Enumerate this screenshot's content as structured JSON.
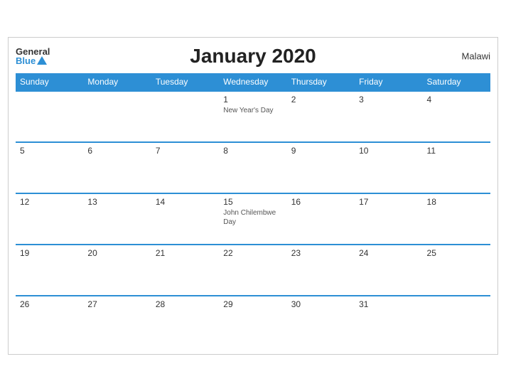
{
  "header": {
    "title": "January 2020",
    "country": "Malawi",
    "logo_general": "General",
    "logo_blue": "Blue"
  },
  "days_of_week": [
    "Sunday",
    "Monday",
    "Tuesday",
    "Wednesday",
    "Thursday",
    "Friday",
    "Saturday"
  ],
  "weeks": [
    [
      {
        "day": "",
        "empty": true
      },
      {
        "day": "",
        "empty": true
      },
      {
        "day": "",
        "empty": true
      },
      {
        "day": "1",
        "holiday": "New Year's Day"
      },
      {
        "day": "2"
      },
      {
        "day": "3"
      },
      {
        "day": "4"
      }
    ],
    [
      {
        "day": "5"
      },
      {
        "day": "6"
      },
      {
        "day": "7"
      },
      {
        "day": "8"
      },
      {
        "day": "9"
      },
      {
        "day": "10"
      },
      {
        "day": "11"
      }
    ],
    [
      {
        "day": "12"
      },
      {
        "day": "13"
      },
      {
        "day": "14"
      },
      {
        "day": "15",
        "holiday": "John Chilembwe Day"
      },
      {
        "day": "16"
      },
      {
        "day": "17"
      },
      {
        "day": "18"
      }
    ],
    [
      {
        "day": "19"
      },
      {
        "day": "20"
      },
      {
        "day": "21"
      },
      {
        "day": "22"
      },
      {
        "day": "23"
      },
      {
        "day": "24"
      },
      {
        "day": "25"
      }
    ],
    [
      {
        "day": "26"
      },
      {
        "day": "27"
      },
      {
        "day": "28"
      },
      {
        "day": "29"
      },
      {
        "day": "30"
      },
      {
        "day": "31"
      },
      {
        "day": "",
        "empty": true
      }
    ]
  ]
}
